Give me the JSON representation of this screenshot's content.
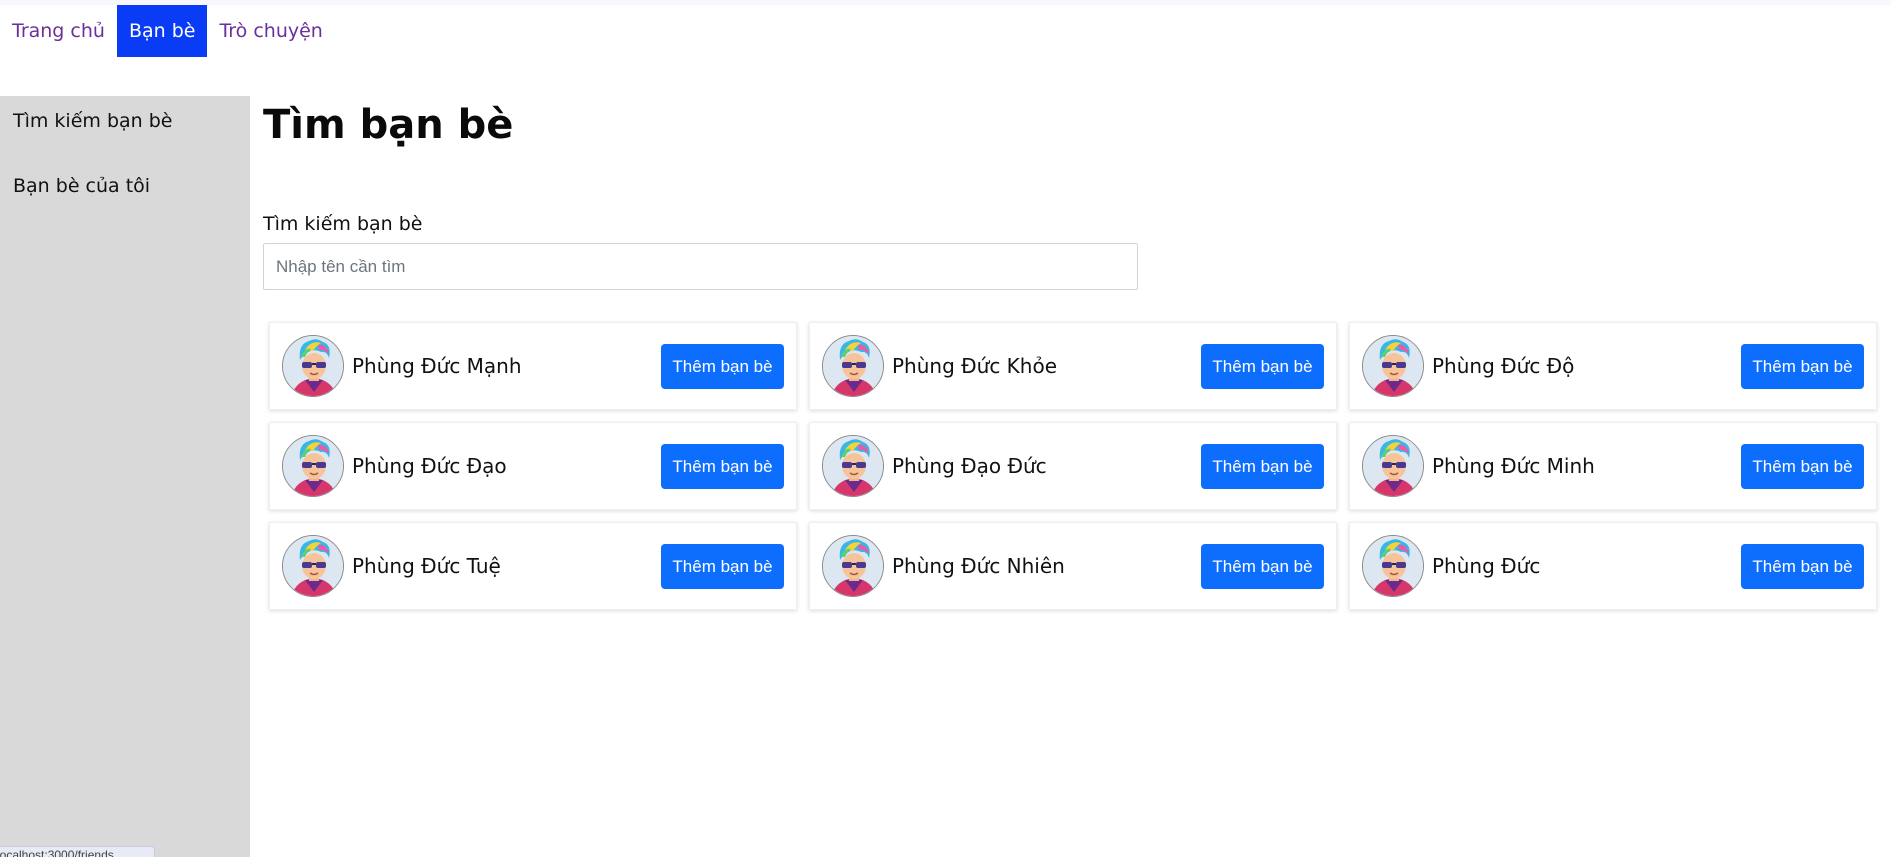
{
  "nav": {
    "items": [
      {
        "label": "Trang chủ",
        "active": false
      },
      {
        "label": "Bạn bè",
        "active": true
      },
      {
        "label": "Trò chuyện",
        "active": false
      }
    ]
  },
  "sidebar": {
    "items": [
      {
        "label": "Tìm kiếm bạn bè"
      },
      {
        "label": "Bạn bè của tôi"
      }
    ]
  },
  "main": {
    "title": "Tìm bạn bè",
    "search_label": "Tìm kiếm bạn bè",
    "search_placeholder": "Nhập tên cần tìm",
    "search_value": ""
  },
  "friends": [
    {
      "name": "Phùng Đức Mạnh",
      "action": "Thêm bạn bè"
    },
    {
      "name": "Phùng Đức Khỏe",
      "action": "Thêm bạn bè"
    },
    {
      "name": "Phùng Đức Độ",
      "action": "Thêm bạn bè"
    },
    {
      "name": "Phùng Đức Đạo",
      "action": "Thêm bạn bè"
    },
    {
      "name": "Phùng Đạo Đức",
      "action": "Thêm bạn bè"
    },
    {
      "name": "Phùng Đức Minh",
      "action": "Thêm bạn bè"
    },
    {
      "name": "Phùng Đức Tuệ",
      "action": "Thêm bạn bè"
    },
    {
      "name": "Phùng Đức Nhiên",
      "action": "Thêm bạn bè"
    },
    {
      "name": "Phùng Đức",
      "action": "Thêm bạn bè"
    }
  ],
  "status_url": "localhost:3000/friends",
  "colors": {
    "nav_active_bg": "#0b3cf5",
    "nav_link": "#6b2f9a",
    "sidebar_bg": "#d9d9d9",
    "button_bg": "#0d6efd"
  }
}
